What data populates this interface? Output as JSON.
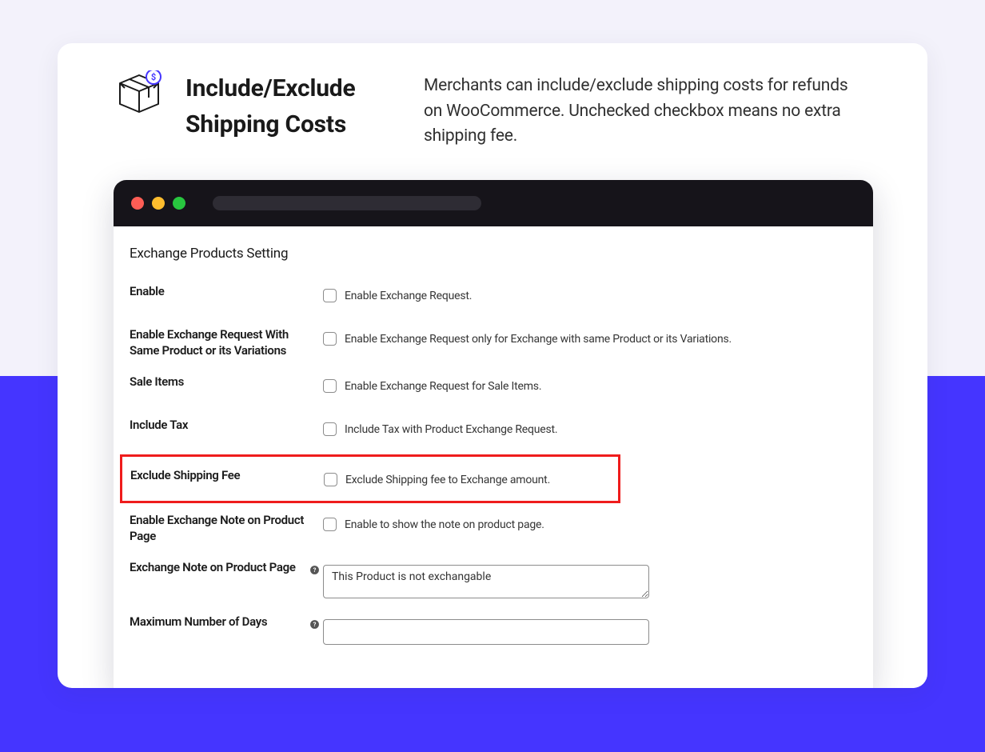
{
  "header": {
    "title": "Include/Exclude Shipping Costs",
    "description": "Merchants can include/exclude shipping costs for refunds on WooCommerce. Unchecked checkbox means no extra shipping fee."
  },
  "panel": {
    "title": "Exchange Products Setting"
  },
  "rows": {
    "enable": {
      "label": "Enable",
      "desc": "Enable Exchange Request."
    },
    "same_product": {
      "label": "Enable Exchange Request With Same Product or its Variations",
      "desc": "Enable Exchange Request only for Exchange with same Product or its Variations."
    },
    "sale_items": {
      "label": "Sale Items",
      "desc": "Enable Exchange Request for Sale Items."
    },
    "include_tax": {
      "label": "Include Tax",
      "desc": "Include Tax with Product Exchange Request."
    },
    "exclude_shipping": {
      "label": "Exclude Shipping Fee",
      "desc": "Exclude Shipping fee to Exchange amount."
    },
    "note_enable": {
      "label": "Enable Exchange Note on Product Page",
      "desc": "Enable to show the note on product page."
    },
    "note_text": {
      "label": "Exchange Note on Product Page",
      "value": "This Product is not exchangable"
    },
    "max_days": {
      "label": "Maximum Number of Days",
      "value": ""
    }
  }
}
